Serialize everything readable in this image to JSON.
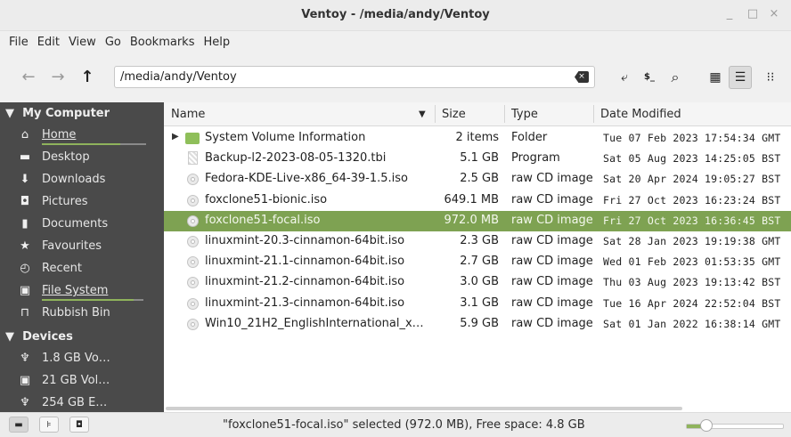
{
  "window": {
    "title": "Ventoy - /media/andy/Ventoy",
    "minimize": "_",
    "maximize": "□",
    "close": "×"
  },
  "menu": [
    "File",
    "Edit",
    "View",
    "Go",
    "Bookmarks",
    "Help"
  ],
  "toolbar": {
    "back": "←",
    "forward": "→",
    "up": "↑",
    "path": "/media/andy/Ventoy",
    "clear": "×",
    "buttons": [
      {
        "icon": "toggle-location-icon",
        "glyph": "⤶"
      },
      {
        "icon": "terminal-icon",
        "glyph": "$_"
      },
      {
        "icon": "search-icon",
        "glyph": "⌕"
      },
      {
        "icon": "icon-view-icon",
        "glyph": "▦"
      },
      {
        "icon": "list-view-icon",
        "glyph": "☰"
      },
      {
        "icon": "compact-view-icon",
        "glyph": "⁝⁝"
      }
    ]
  },
  "sidebar": {
    "my_computer": "My Computer",
    "devices": "Devices",
    "places": [
      {
        "label": "Home",
        "icon": "home-icon",
        "glyph": "⌂",
        "usage": 0.75
      },
      {
        "label": "Desktop",
        "icon": "desktop-icon",
        "glyph": "▬"
      },
      {
        "label": "Downloads",
        "icon": "download-icon",
        "glyph": "⬇"
      },
      {
        "label": "Pictures",
        "icon": "camera-icon",
        "glyph": "◘"
      },
      {
        "label": "Documents",
        "icon": "document-icon",
        "glyph": "▮"
      },
      {
        "label": "Favourites",
        "icon": "star-icon",
        "glyph": "★"
      },
      {
        "label": "Recent",
        "icon": "clock-icon",
        "glyph": "◴"
      },
      {
        "label": "File System",
        "icon": "drive-icon",
        "glyph": "▣",
        "usage": 0.9
      },
      {
        "label": "Rubbish Bin",
        "icon": "trash-icon",
        "glyph": "⊓"
      }
    ],
    "device_items": [
      {
        "label": "1.8 GB Vo…",
        "icon": "usb-icon",
        "glyph": "♆"
      },
      {
        "label": "21 GB Vol…",
        "icon": "drive-icon",
        "glyph": "▣"
      },
      {
        "label": "254 GB E…",
        "icon": "usb-icon",
        "glyph": "♆"
      }
    ]
  },
  "columns": {
    "name": "Name",
    "size": "Size",
    "type": "Type",
    "date": "Date Modified"
  },
  "files": [
    {
      "name": "System Volume Information",
      "size": "2 items",
      "type": "Folder",
      "date": "Tue 07 Feb 2023 17:54:34 GMT",
      "kind": "folder"
    },
    {
      "name": "Backup-l2-2023-08-05-1320.tbi",
      "size": "5.1 GB",
      "type": "Program",
      "date": "Sat 05 Aug 2023 14:25:05 BST",
      "kind": "program"
    },
    {
      "name": "Fedora-KDE-Live-x86_64-39-1.5.iso",
      "size": "2.5 GB",
      "type": "raw CD image",
      "date": "Sat 20 Apr 2024 19:05:27 BST",
      "kind": "iso"
    },
    {
      "name": "foxclone51-bionic.iso",
      "size": "649.1 MB",
      "type": "raw CD image",
      "date": "Fri 27 Oct 2023 16:23:24 BST",
      "kind": "iso"
    },
    {
      "name": "foxclone51-focal.iso",
      "size": "972.0 MB",
      "type": "raw CD image",
      "date": "Fri 27 Oct 2023 16:36:45 BST",
      "kind": "iso",
      "selected": true
    },
    {
      "name": "linuxmint-20.3-cinnamon-64bit.iso",
      "size": "2.3 GB",
      "type": "raw CD image",
      "date": "Sat 28 Jan 2023 19:19:38 GMT",
      "kind": "iso"
    },
    {
      "name": "linuxmint-21.1-cinnamon-64bit.iso",
      "size": "2.7 GB",
      "type": "raw CD image",
      "date": "Wed 01 Feb 2023 01:53:35 GMT",
      "kind": "iso"
    },
    {
      "name": "linuxmint-21.2-cinnamon-64bit.iso",
      "size": "3.0 GB",
      "type": "raw CD image",
      "date": "Thu 03 Aug 2023 19:13:42 BST",
      "kind": "iso"
    },
    {
      "name": "linuxmint-21.3-cinnamon-64bit.iso",
      "size": "3.1 GB",
      "type": "raw CD image",
      "date": "Tue 16 Apr 2024 22:52:04 BST",
      "kind": "iso"
    },
    {
      "name": "Win10_21H2_EnglishInternational_x…",
      "size": "5.9 GB",
      "type": "raw CD image",
      "date": "Sat 01 Jan 2022 16:38:14 GMT",
      "kind": "iso"
    }
  ],
  "status": {
    "text": "\"foxclone51-focal.iso\" selected (972.0 MB), Free space: 4.8 GB",
    "zoom": 0.2
  },
  "colors": {
    "accent": "#8fb35c",
    "selected_row": "#7ea252",
    "sidebar_bg": "#4a4a4a"
  }
}
